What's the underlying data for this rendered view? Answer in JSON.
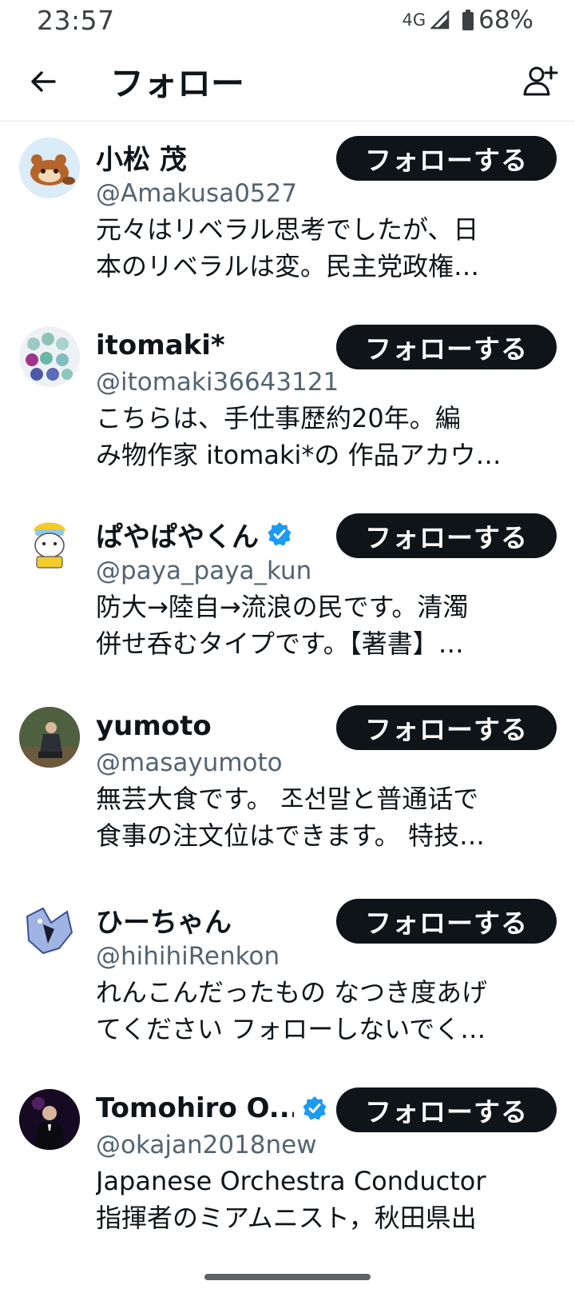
{
  "status_bar": {
    "time": "23:57",
    "network": "4G",
    "battery": "68%"
  },
  "header": {
    "title": "フォロー",
    "back_icon": "arrow-left-icon",
    "add_icon": "add-user-icon"
  },
  "colors": {
    "follow_button_bg": "#0f1419",
    "verified": "#1d9bf0",
    "handle": "#536471"
  },
  "users": [
    {
      "name": "小松 茂",
      "handle": "@Amakusa0527",
      "bio_line1": "元々はリベラル思考でしたが、日",
      "bio_line2": "本のリベラルは変。民主党政権…",
      "follow_label": "フォローする",
      "verified": false
    },
    {
      "name": "itomaki*",
      "handle": "@itomaki36643121",
      "bio_line1": "こちらは、手仕事歴約20年。編",
      "bio_line2": "み物作家 itomaki*の 作品アカウ…",
      "follow_label": "フォローする",
      "verified": false
    },
    {
      "name": "ぱやぱやくん",
      "handle": "@paya_paya_kun",
      "bio_line1": "防大→陸自→流浪の民です。清濁",
      "bio_line2": "併せ呑むタイプです。【著書】…",
      "follow_label": "フォローする",
      "verified": true
    },
    {
      "name": "yumoto",
      "handle": "@masayumoto",
      "bio_line1": "無芸大食です。 조선말と普通话で",
      "bio_line2": "食事の注文位はできます。 特技…",
      "follow_label": "フォローする",
      "verified": false
    },
    {
      "name": "ひーちゃん",
      "handle": "@hihihiRenkon",
      "bio_line1": "れんこんだったもの なつき度あげ",
      "bio_line2": "てください フォローしないでく…",
      "follow_label": "フォローする",
      "verified": false
    },
    {
      "name": "Tomohiro O...",
      "handle": "@okajan2018new",
      "bio_line1": "Japanese Orchestra Conductor",
      "bio_line2": "指揮者のミアムニスト，秋田県出",
      "follow_label": "フォローする",
      "verified": true
    }
  ]
}
